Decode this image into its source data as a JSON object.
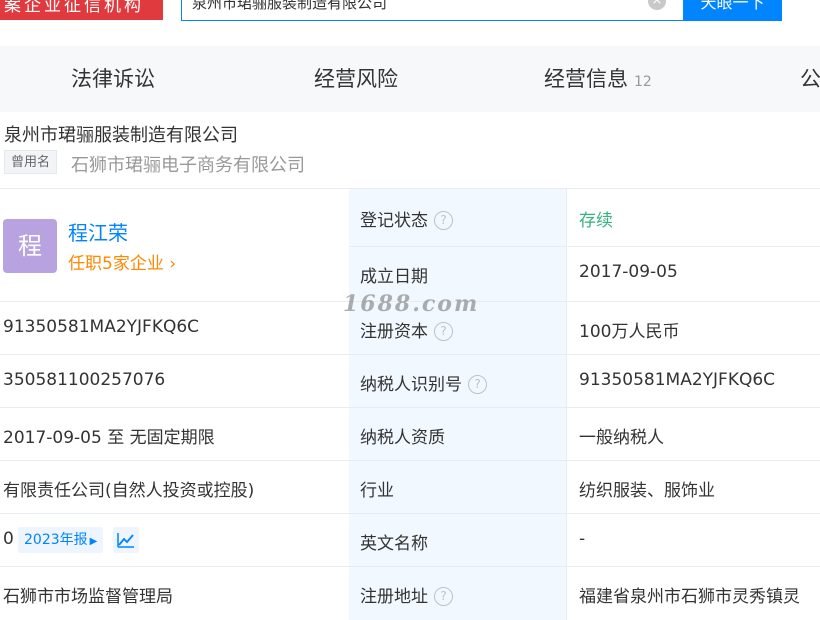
{
  "topbar": {
    "left_badge": "案企业征信机构",
    "search_value": "泉州市珺骊服装制造有限公司",
    "search_button": "天眼一下"
  },
  "tabs": [
    {
      "label": "法律诉讼",
      "count": ""
    },
    {
      "label": "经营风险",
      "count": ""
    },
    {
      "label": "经营信息",
      "count": "12"
    },
    {
      "label": "公",
      "count": ""
    }
  ],
  "company": {
    "name": "泉州市珺骊服装制造有限公司",
    "former_tag": "曾用名",
    "former_name": "石狮市珺骊电子商务有限公司"
  },
  "person": {
    "avatar_char": "程",
    "name": "程江荣",
    "link": "任职5家企业",
    "link_arrow": "›"
  },
  "rows": {
    "credit_code": "91350581MA2YJFKQ6C",
    "reg_no": "350581100257076",
    "term": "2017-09-05 至 无固定期限",
    "company_type": "有限责任公司(自然人投资或控股)",
    "zero": "0",
    "report": "2023年报",
    "authority": "石狮市市场监督管理局"
  },
  "labels": {
    "status": "登记状态",
    "found_date": "成立日期",
    "capital": "注册资本",
    "taxpayer_id": "纳税人识别号",
    "taxpayer_qual": "纳税人资质",
    "industry": "行业",
    "english_name": "英文名称",
    "reg_address": "注册地址"
  },
  "values": {
    "status": "存续",
    "found_date": "2017-09-05",
    "capital": "100万人民币",
    "taxpayer_id": "91350581MA2YJFKQ6C",
    "taxpayer_qual": "一般纳税人",
    "industry": "纺织服装、服饰业",
    "english_name": "-",
    "reg_address": "福建省泉州市石狮市灵秀镇灵"
  },
  "watermark": "1688.com",
  "icons": {
    "help": "?",
    "clear": "×"
  },
  "colors": {
    "brand_blue": "#0084ff",
    "badge_red": "#e03a3e",
    "status_green": "#36b37e",
    "link_orange": "#ff8800",
    "avatar_purple": "#b9a2e0",
    "label_bg": "#f2f8ff"
  }
}
